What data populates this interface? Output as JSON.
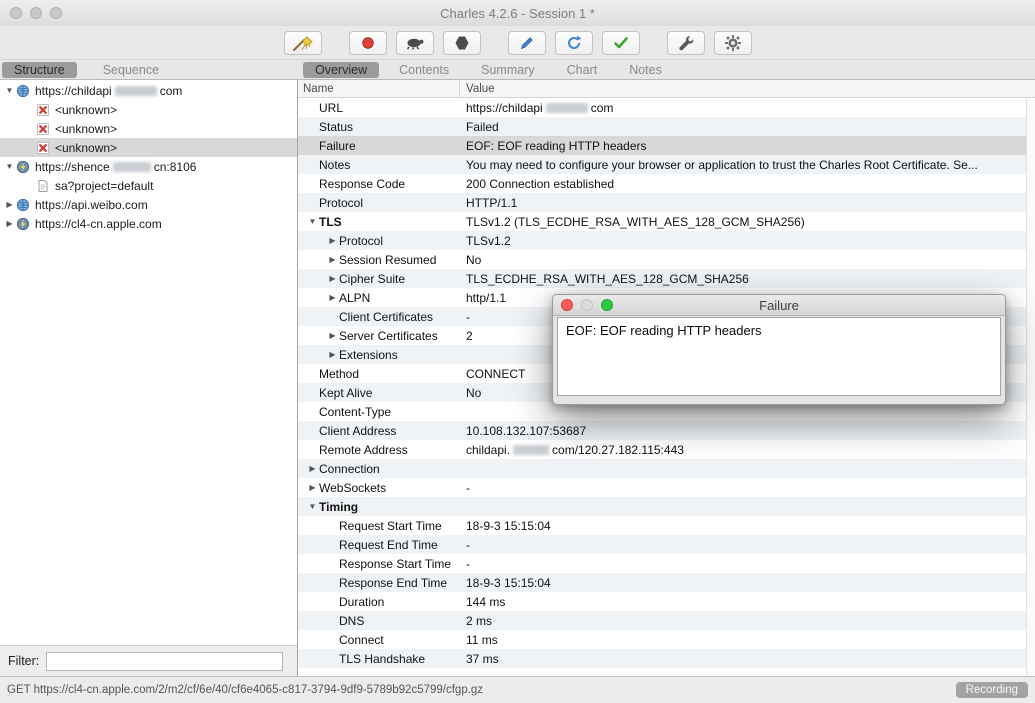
{
  "window": {
    "title": "Charles 4.2.6 - Session 1 *"
  },
  "colors": {
    "record_red": "#e0423a",
    "validate_green": "#43a13a",
    "compose_blue": "#4584cf",
    "broom_yellow": "#f2cb47",
    "selection_gray": "#d8d8d8",
    "row_stripe": "#eff3f6"
  },
  "toolbar": {
    "groups": [
      [
        "broom"
      ],
      [
        "record",
        "throttle",
        "breakpoints"
      ],
      [
        "compose",
        "repeat",
        "validate"
      ],
      [
        "tools",
        "settings"
      ]
    ]
  },
  "tabs": {
    "left": [
      {
        "label": "Structure",
        "active": true
      },
      {
        "label": "Sequence",
        "active": false
      }
    ],
    "right": [
      {
        "label": "Overview",
        "active": true
      },
      {
        "label": "Contents",
        "active": false
      },
      {
        "label": "Summary",
        "active": false
      },
      {
        "label": "Chart",
        "active": false
      },
      {
        "label": "Notes",
        "active": false
      }
    ]
  },
  "tree": {
    "items": [
      {
        "icon": "globe",
        "arrow": "down",
        "indent": 0,
        "parts": [
          {
            "text": "https://childapi"
          },
          {
            "redact": 42
          },
          {
            "text": "com"
          }
        ]
      },
      {
        "icon": "error",
        "indent": 1,
        "parts": [
          {
            "text": "<unknown>"
          }
        ]
      },
      {
        "icon": "error",
        "indent": 1,
        "parts": [
          {
            "text": "<unknown>"
          }
        ]
      },
      {
        "icon": "error",
        "indent": 1,
        "selected": true,
        "parts": [
          {
            "text": "<unknown>"
          }
        ]
      },
      {
        "icon": "lightning",
        "arrow": "down",
        "indent": 0,
        "parts": [
          {
            "text": "https://shence"
          },
          {
            "redact": 38
          },
          {
            "text": "cn:8106"
          }
        ]
      },
      {
        "icon": "document",
        "indent": 1,
        "parts": [
          {
            "text": "sa?project=default"
          }
        ]
      },
      {
        "icon": "globe",
        "arrow": "right",
        "indent": 0,
        "parts": [
          {
            "text": "https://api.weibo.com"
          }
        ]
      },
      {
        "icon": "lightning",
        "arrow": "right",
        "indent": 0,
        "parts": [
          {
            "text": "https://cl4-cn.apple.com"
          }
        ]
      }
    ]
  },
  "table": {
    "columns": [
      "Name",
      "Value"
    ],
    "rows": [
      {
        "name": "URL",
        "parts": [
          {
            "text": "https://childapi"
          },
          {
            "redact": 42
          },
          {
            "text": "com"
          }
        ]
      },
      {
        "name": "Status",
        "value": "Failed"
      },
      {
        "name": "Failure",
        "value": "EOF: EOF reading HTTP headers",
        "selected": true
      },
      {
        "name": "Notes",
        "value": "You may need to configure your browser or application to trust the Charles Root Certificate. Se..."
      },
      {
        "name": "Response Code",
        "value": "200 Connection established"
      },
      {
        "name": "Protocol",
        "value": "HTTP/1.1"
      },
      {
        "name": "TLS",
        "value": "TLSv1.2 (TLS_ECDHE_RSA_WITH_AES_128_GCM_SHA256)",
        "arrow": "down",
        "bold": true
      },
      {
        "name": "Protocol",
        "value": "TLSv1.2",
        "arrow": "right",
        "indent": 1
      },
      {
        "name": "Session Resumed",
        "value": "No",
        "arrow": "right",
        "indent": 1
      },
      {
        "name": "Cipher Suite",
        "value": "TLS_ECDHE_RSA_WITH_AES_128_GCM_SHA256",
        "arrow": "right",
        "indent": 1
      },
      {
        "name": "ALPN",
        "value": "http/1.1",
        "arrow": "right",
        "indent": 1
      },
      {
        "name": "Client Certificates",
        "value": "-",
        "indent": 1
      },
      {
        "name": "Server Certificates",
        "value": "2",
        "arrow": "right",
        "indent": 1
      },
      {
        "name": "Extensions",
        "value": "",
        "arrow": "right",
        "indent": 1
      },
      {
        "name": "Method",
        "value": "CONNECT"
      },
      {
        "name": "Kept Alive",
        "value": "No"
      },
      {
        "name": "Content-Type",
        "value": ""
      },
      {
        "name": "Client Address",
        "value": "10.108.132.107:53687"
      },
      {
        "name": "Remote Address",
        "parts": [
          {
            "text": "childapi."
          },
          {
            "redact": 36
          },
          {
            "text": "com/120.27.182.115:443"
          }
        ]
      },
      {
        "name": "Connection",
        "value": "",
        "arrow": "right"
      },
      {
        "name": "WebSockets",
        "value": "-",
        "arrow": "right"
      },
      {
        "name": "Timing",
        "value": "",
        "arrow": "down",
        "bold": true
      },
      {
        "name": "Request Start Time",
        "value": "18-9-3 15:15:04",
        "indent": 1
      },
      {
        "name": "Request End Time",
        "value": "-",
        "indent": 1
      },
      {
        "name": "Response Start Time",
        "value": "-",
        "indent": 1
      },
      {
        "name": "Response End Time",
        "value": "18-9-3 15:15:04",
        "indent": 1
      },
      {
        "name": "Duration",
        "value": "144 ms",
        "indent": 1
      },
      {
        "name": "DNS",
        "value": "2 ms",
        "indent": 1
      },
      {
        "name": "Connect",
        "value": "11 ms",
        "indent": 1
      },
      {
        "name": "TLS Handshake",
        "value": "37 ms",
        "indent": 1
      }
    ]
  },
  "popup": {
    "title": "Failure",
    "text": "EOF: EOF reading HTTP headers"
  },
  "filter": {
    "label": "Filter:",
    "value": ""
  },
  "status_bar": {
    "text": "GET https://cl4-cn.apple.com/2/m2/cf/6e/40/cf6e4065-c817-3794-9df9-5789b92c5799/cfgp.gz",
    "badge": "Recording"
  }
}
